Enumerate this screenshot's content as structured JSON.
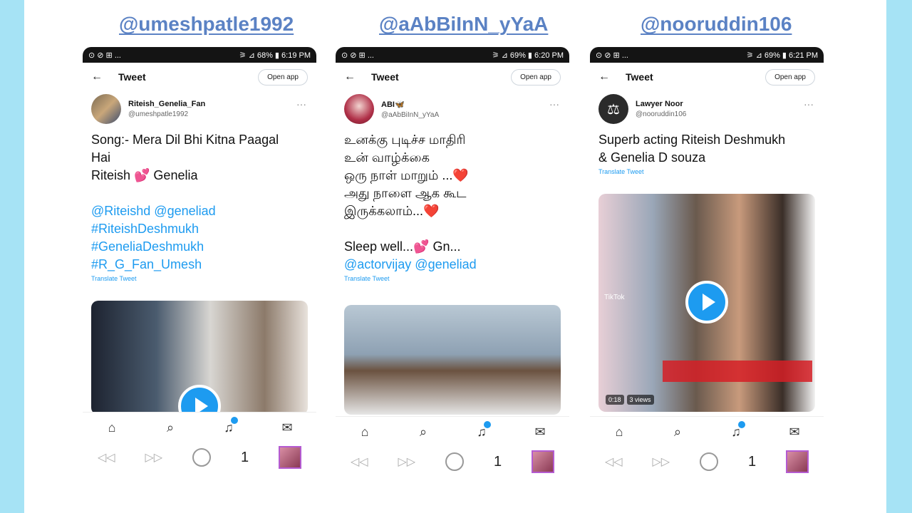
{
  "handles": [
    "@umeshpatle1992",
    "@aAbBiInN_yYaA",
    "@nooruddin106"
  ],
  "common": {
    "back": "←",
    "tweet_title": "Tweet",
    "open_app": "Open app",
    "more": "···",
    "translate": "Translate Tweet",
    "nav_number": "1"
  },
  "phones": [
    {
      "status_left": "⊙ ⊘ ⊞ ...",
      "status_right": "⚞ ⊿ 68% ▮ 6:19 PM",
      "name": "Riteish_Genelia_Fan",
      "username": "@umeshpatle1992",
      "lines": [
        "Song:- Mera Dil Bhi Kitna Paagal",
        "Hai",
        "Riteish 💕 Genelia",
        "",
        "@Riteishd @geneliad",
        "#RiteishDeshmukh",
        "#GeneliaDeshmukh",
        "#R_G_Fan_Umesh"
      ]
    },
    {
      "status_left": "⊙ ⊘ ⊞ ...",
      "status_right": "⚞ ⊿ 69% ▮ 6:20 PM",
      "name": "ABI🦋",
      "username": "@aAbBiInN_yYaA",
      "lines": [
        "உனக்கு புடிச்ச மாதிரி",
        "உன் வாழ்க்கை",
        "ஒரு நாள் மாறும் ...❤️",
        "அது நாளை ஆக கூட",
        "இருக்கலாம்...❤️",
        "",
        "Sleep well...💕 Gn...",
        "@actorvijay @geneliad"
      ]
    },
    {
      "status_left": "⊙ ⊘ ⊞ ...",
      "status_right": "⚞ ⊿ 69% ▮ 6:21 PM",
      "name": "Lawyer Noor",
      "username": "@nooruddin106",
      "lines": [
        "Superb acting Riteish Deshmukh",
        "& Genelia D souza"
      ],
      "video_time": "0:18",
      "video_views": "3 views",
      "tiktok": "TikTok"
    }
  ],
  "colors": {
    "background": "#a6e3f5",
    "link": "#1d9bf0",
    "handle": "#5b82c4"
  }
}
